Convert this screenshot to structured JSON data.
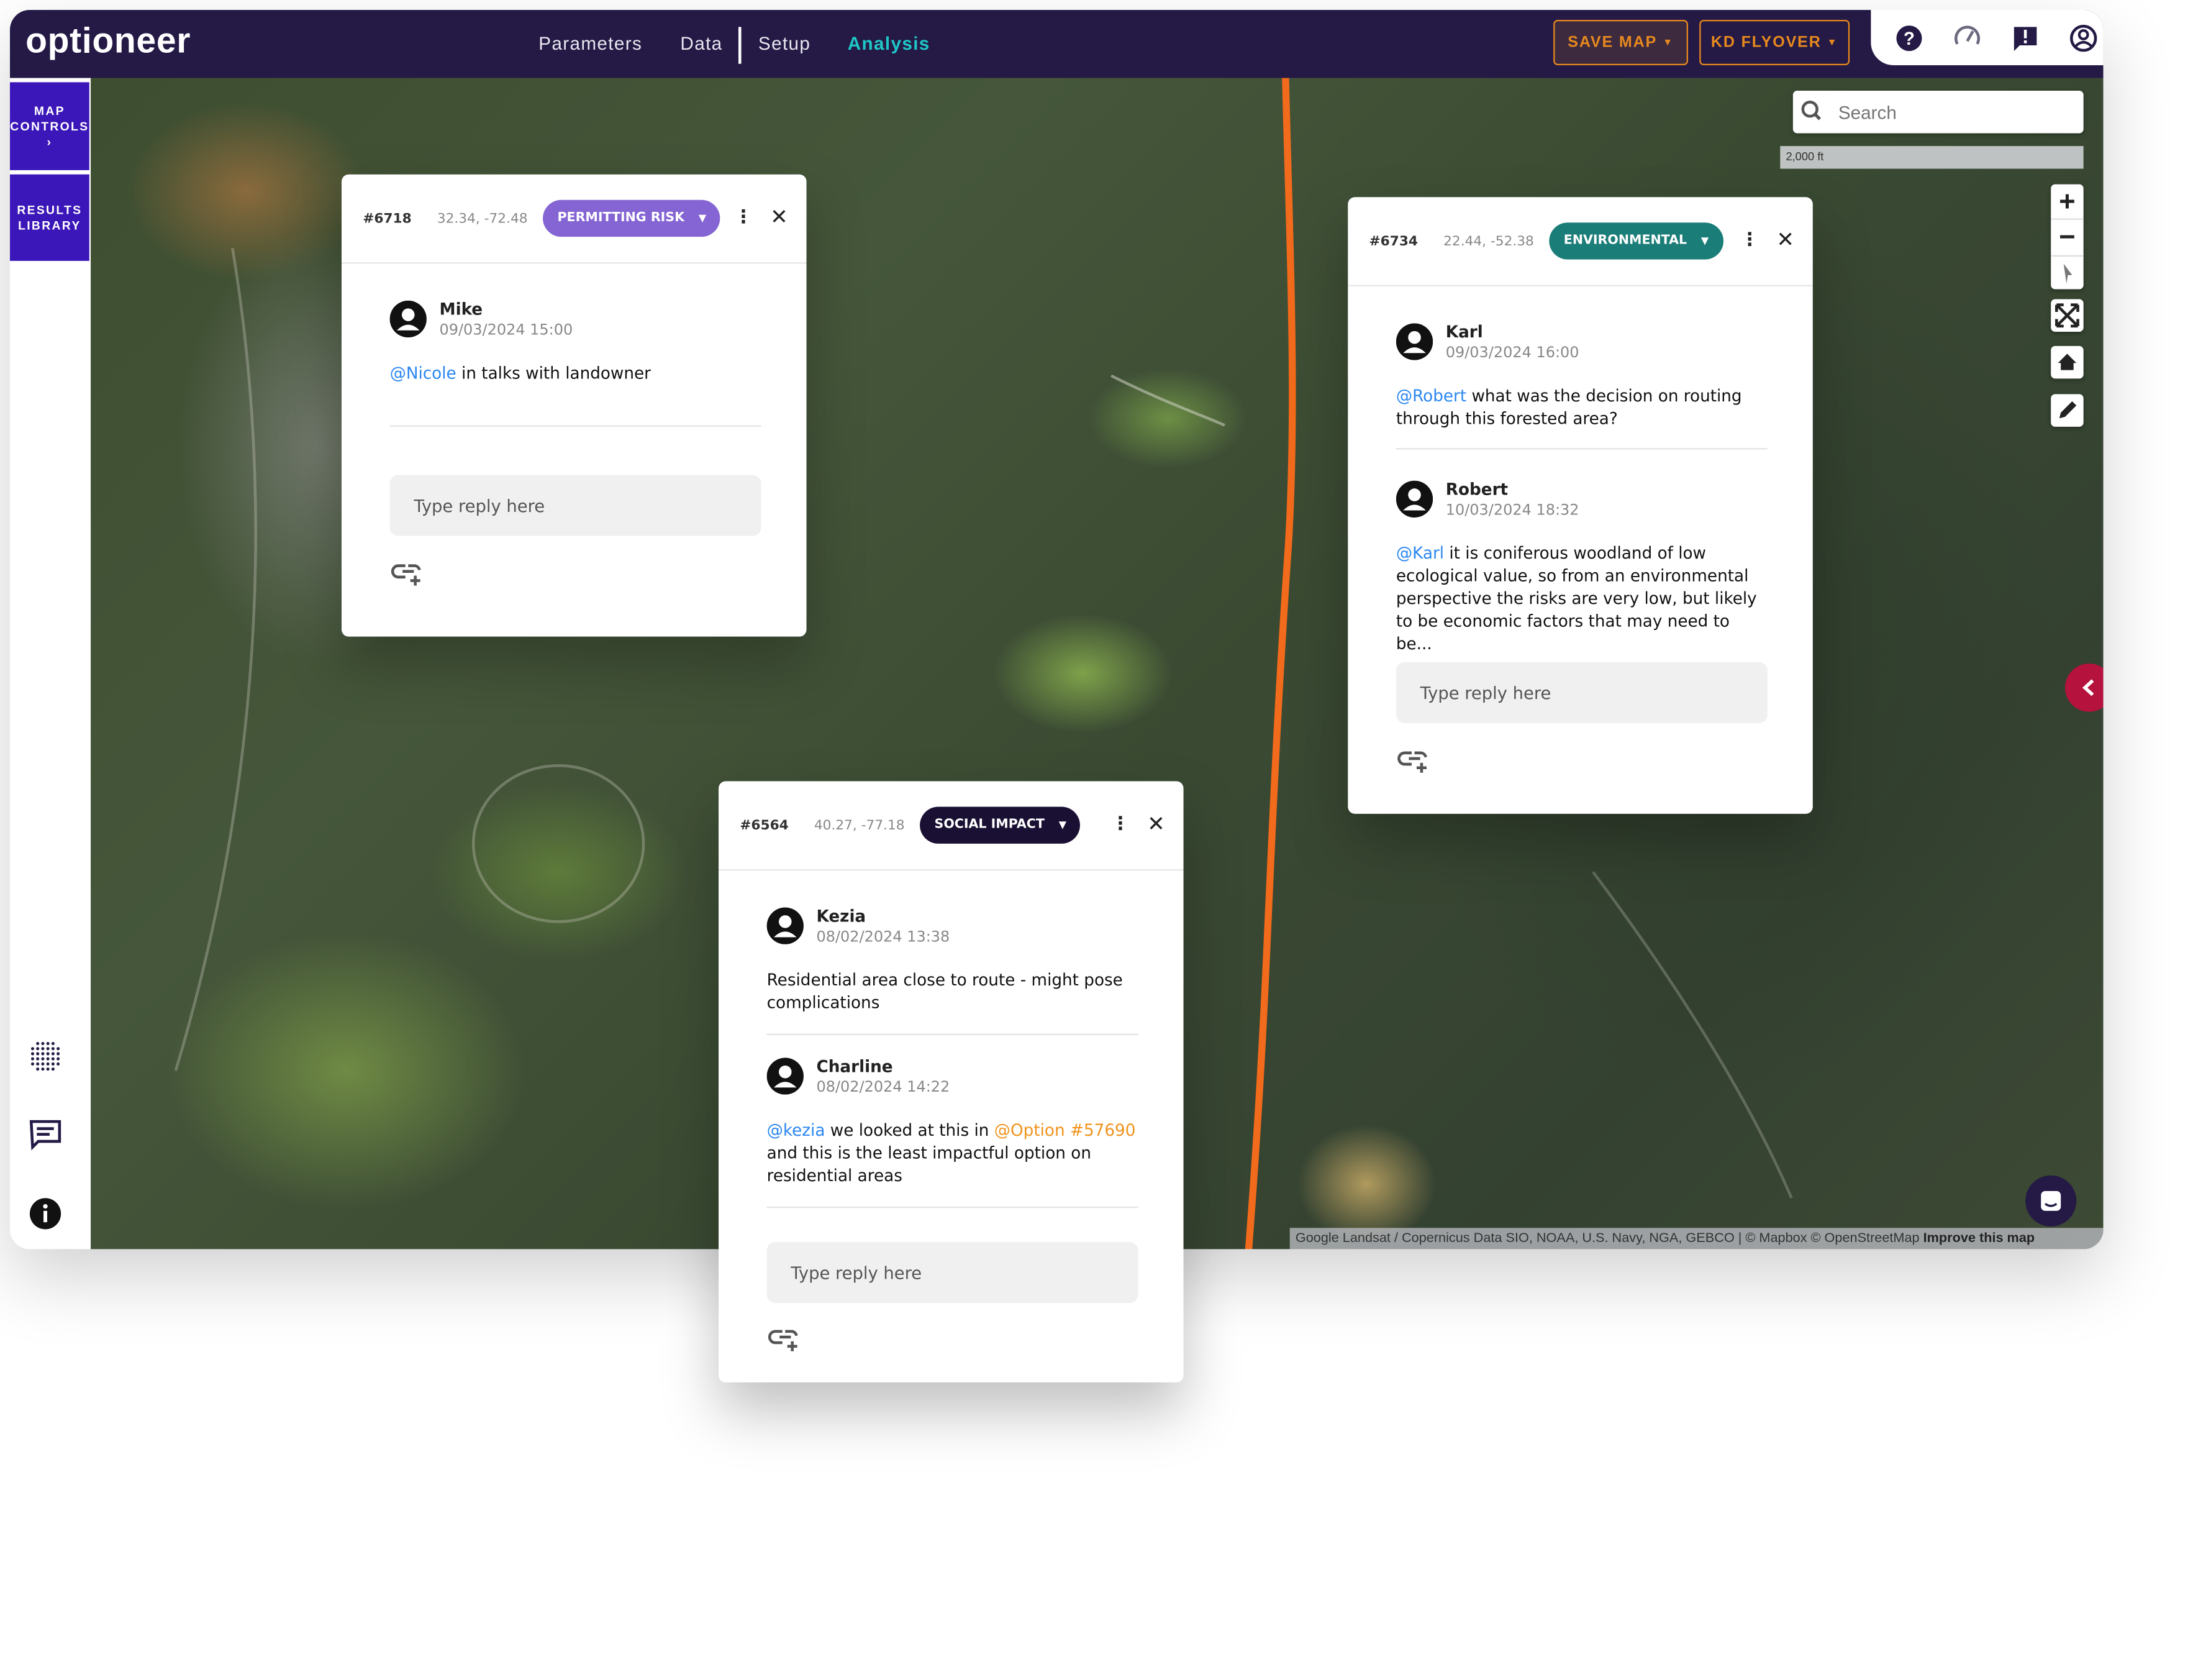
{
  "app": {
    "logo": "optioneer"
  },
  "nav": {
    "items": [
      {
        "label": "Parameters",
        "active": false
      },
      {
        "label": "Data",
        "active": false
      },
      {
        "label": "Setup",
        "active": false
      },
      {
        "label": "Analysis",
        "active": true
      }
    ]
  },
  "header_buttons": {
    "save_map": "SAVE MAP",
    "kd_flyover": "KD FLYOVER"
  },
  "header_icons": [
    "help-icon",
    "speedometer-icon",
    "feedback-icon",
    "account-icon"
  ],
  "sidebar": {
    "map_controls": [
      "MAP",
      "CONTROLS",
      "›"
    ],
    "results_library": [
      "RESULTS",
      "LIBRARY"
    ],
    "bottom_icons": [
      "grid-dots-icon",
      "comments-icon",
      "info-icon"
    ]
  },
  "map": {
    "search_placeholder": "Search",
    "scale": "2,000 ft",
    "attribution": "Google Landsat / Copernicus Data SIO, NOAA, U.S. Navy, NGA, GEBCO | © Mapbox © OpenStreetMap",
    "improve_link": "Improve this map",
    "route_color": "#f26a1b",
    "controls": [
      "zoom-in-icon",
      "zoom-out-icon",
      "compass-icon",
      "fullscreen-icon",
      "home-icon",
      "pencil-icon"
    ]
  },
  "colors": {
    "header": "#241a45",
    "sidebar_button": "#3b16b8",
    "accent_teal": "#1fc7c7",
    "accent_orange": "#e8891e",
    "collapse_button": "#b5123e"
  },
  "cards": [
    {
      "id": "#6718",
      "coords": "32.34, -72.48",
      "tag": "PERMITTING RISK",
      "tag_color": "#8465d3",
      "reply_placeholder": "Type reply here",
      "comments": [
        {
          "name": "Mike",
          "date": "09/03/2024 15:00",
          "text": [
            {
              "t": "@Nicole",
              "k": "mention"
            },
            {
              "t": " in talks with landowner",
              "k": "plain"
            }
          ]
        }
      ]
    },
    {
      "id": "#6734",
      "coords": "22.44, -52.38",
      "tag": "ENVIRONMENTAL",
      "tag_color": "#1b7d78",
      "reply_placeholder": "Type reply here",
      "comments": [
        {
          "name": "Karl",
          "date": "09/03/2024 16:00",
          "text": [
            {
              "t": "@Robert",
              "k": "mention"
            },
            {
              "t": " what was the decision on routing through this forested area?",
              "k": "plain"
            }
          ]
        },
        {
          "name": "Robert",
          "date": "10/03/2024 18:32",
          "text": [
            {
              "t": "@Karl",
              "k": "mention"
            },
            {
              "t": " it is coniferous woodland of low ecological value, so from an environmental perspective the risks are very low, but likely to be economic factors that may need to be...",
              "k": "plain"
            }
          ]
        }
      ]
    },
    {
      "id": "#6564",
      "coords": "40.27, -77.18",
      "tag": "SOCIAL IMPACT",
      "tag_color": "#1a1033",
      "reply_placeholder": "Type reply here",
      "comments": [
        {
          "name": "Kezia",
          "date": "08/02/2024 13:38",
          "text": [
            {
              "t": "Residential area close to route - might pose complications",
              "k": "plain"
            }
          ]
        },
        {
          "name": "Charline",
          "date": "08/02/2024 14:22",
          "text": [
            {
              "t": "@kezia",
              "k": "mention"
            },
            {
              "t": " we looked at this in ",
              "k": "plain"
            },
            {
              "t": "@Option #57690",
              "k": "optref"
            },
            {
              "t": " and this is the least impactful option on residential areas",
              "k": "plain"
            }
          ]
        }
      ]
    }
  ]
}
